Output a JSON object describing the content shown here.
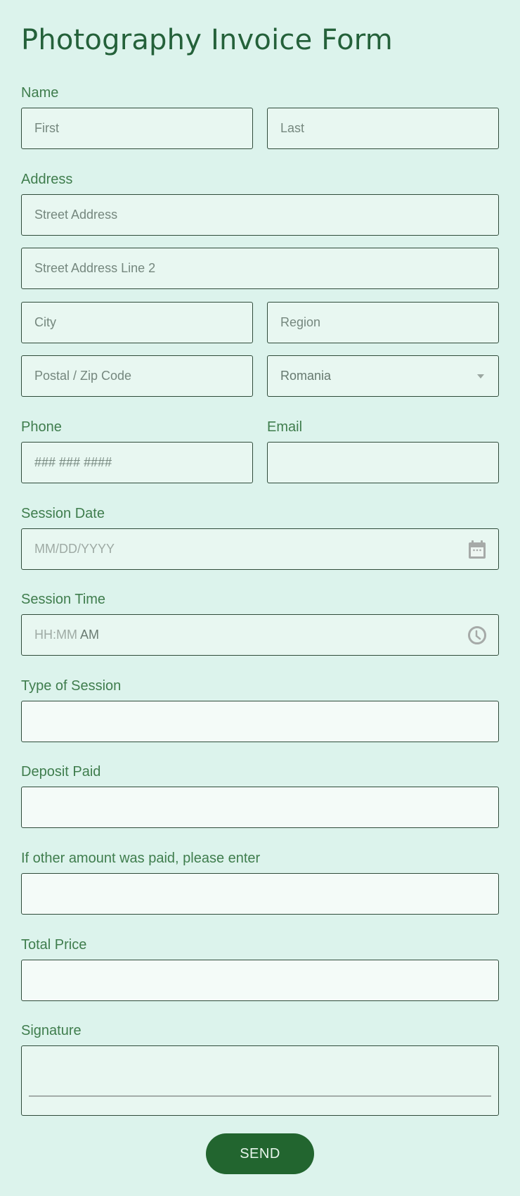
{
  "form": {
    "title": "Photography Invoice Form",
    "fields": {
      "name": {
        "label": "Name",
        "first_placeholder": "First",
        "last_placeholder": "Last"
      },
      "address": {
        "label": "Address",
        "street_placeholder": "Street Address",
        "street2_placeholder": "Street Address Line 2",
        "city_placeholder": "City",
        "region_placeholder": "Region",
        "postal_placeholder": "Postal / Zip Code",
        "country_selected": "Romania"
      },
      "phone": {
        "label": "Phone",
        "placeholder": "### ### ####"
      },
      "email": {
        "label": "Email",
        "value": ""
      },
      "session_date": {
        "label": "Session Date",
        "placeholder": "MM/DD/YYYY",
        "icon": "calendar-icon"
      },
      "session_time": {
        "label": "Session Time",
        "placeholder_time": "HH:MM",
        "ampm": "AM",
        "icon": "clock-icon"
      },
      "type_of_session": {
        "label": "Type of Session",
        "value": ""
      },
      "deposit_paid": {
        "label": "Deposit Paid",
        "value": ""
      },
      "other_amount": {
        "label": "If other amount was paid, please enter",
        "value": ""
      },
      "total_price": {
        "label": "Total Price",
        "value": ""
      },
      "signature": {
        "label": "Signature"
      }
    },
    "submit_label": "SEND"
  },
  "colors": {
    "background": "#dcf3ec",
    "accent": "#22652f",
    "label": "#3f7d4d",
    "border": "#2f4b3a"
  }
}
